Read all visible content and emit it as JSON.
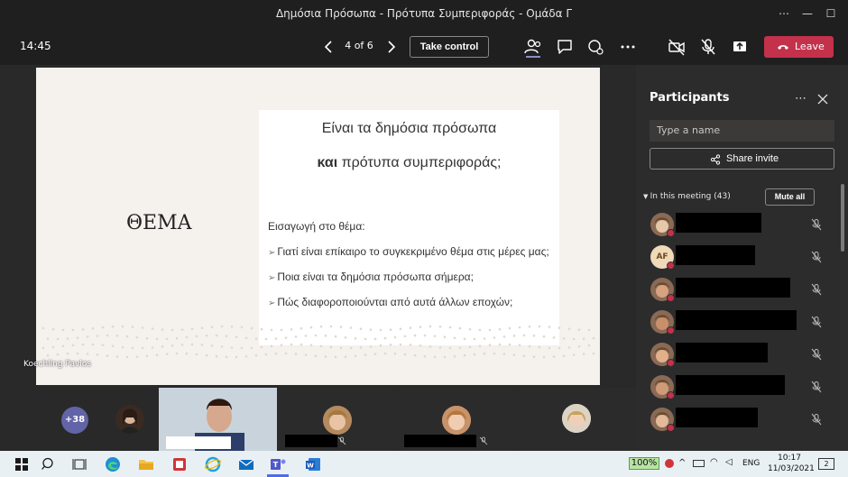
{
  "window": {
    "title": "Δημόσια Πρόσωπα - Πρότυπα Συμπεριφοράς - Ομάδα Γ"
  },
  "toolbar": {
    "time": "14:45",
    "page_counter": "4 of 6",
    "take_control_label": "Take control",
    "leave_label": "Leave"
  },
  "slide": {
    "theme": "ΘΕΜΑ",
    "heading_line1": "Είναι τα δημόσια πρόσωπα",
    "heading_bold": "και",
    "heading_line2_rest": " πρότυπα συμπεριφοράς;",
    "intro": "Εισαγωγή στο θέμα:",
    "bullets": [
      "Γιατί είναι επίκαιρο το συγκεκριμένο θέμα στις μέρες μας;",
      "Ποια είναι τα δημόσια πρόσωπα σήμερα;",
      "Πώς διαφοροποιούνται από αυτά άλλων εποχών;"
    ],
    "presenter": "Koechling Pavlos"
  },
  "participants": {
    "title": "Participants",
    "search_placeholder": "Type a name",
    "share_invite_label": "Share invite",
    "in_meeting_label": "In this meeting (43)",
    "mute_all_label": "Mute all",
    "rows": [
      {
        "initials": ""
      },
      {
        "initials": "AF"
      },
      {
        "initials": ""
      },
      {
        "initials": ""
      },
      {
        "initials": ""
      },
      {
        "initials": ""
      },
      {
        "initials": ""
      }
    ]
  },
  "video_strip": {
    "overflow_count": "+38"
  },
  "taskbar": {
    "battery": "100%",
    "language": "ENG",
    "clock_time": "10:17",
    "clock_date": "11/03/2021",
    "notification_count": "2"
  },
  "colors": {
    "leave_red": "#c4314b",
    "teams_purple": "#6264a7",
    "slide_bg": "#f5f1ed"
  }
}
